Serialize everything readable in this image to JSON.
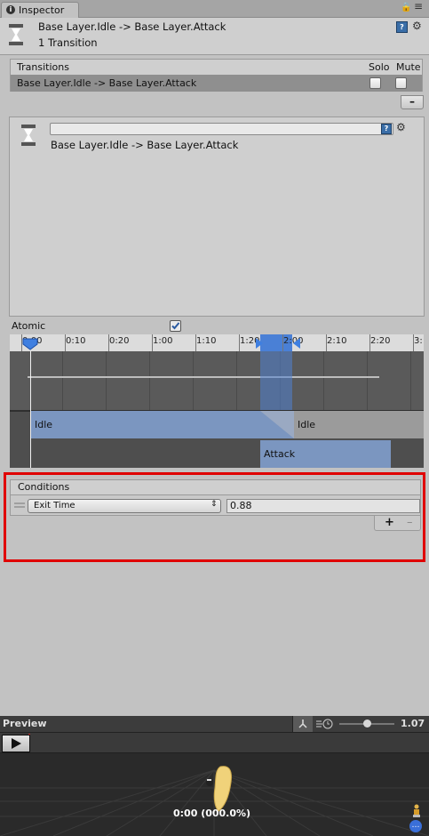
{
  "tabs": {
    "inspector": "Inspector"
  },
  "header": {
    "title": "Base Layer.Idle -> Base Layer.Attack",
    "subtitle": "1 Transition"
  },
  "transitions": {
    "header": {
      "label": "Transitions",
      "solo": "Solo",
      "mute": "Mute"
    },
    "rows": [
      {
        "name": "Base Layer.Idle -> Base Layer.Attack",
        "solo": false,
        "mute": false
      }
    ],
    "remove_label": "–"
  },
  "transition_detail": {
    "name_value": "",
    "description": "Base Layer.Idle -> Base Layer.Attack"
  },
  "timeline": {
    "atomic_label": "Atomic",
    "atomic_checked": true,
    "ticks": [
      "0:00",
      "0:10",
      "0:20",
      "1:00",
      "1:10",
      "1:20",
      "2:00",
      "2:10",
      "2:20",
      "3:"
    ],
    "clips": {
      "source": "Idle",
      "source_next": "Idle",
      "target": "Attack"
    }
  },
  "conditions": {
    "header": "Conditions",
    "rows": [
      {
        "parameter": "Exit Time",
        "value": "0.88"
      }
    ],
    "add_label": "+",
    "remove_label": "–"
  },
  "preview": {
    "title": "Preview",
    "speed": "1.07",
    "time": "0:00 (000.0%)"
  },
  "colors": {
    "accent": "#3a72c9",
    "highlight_frame": "#e00000",
    "clip_blue": "#7b96c0"
  }
}
